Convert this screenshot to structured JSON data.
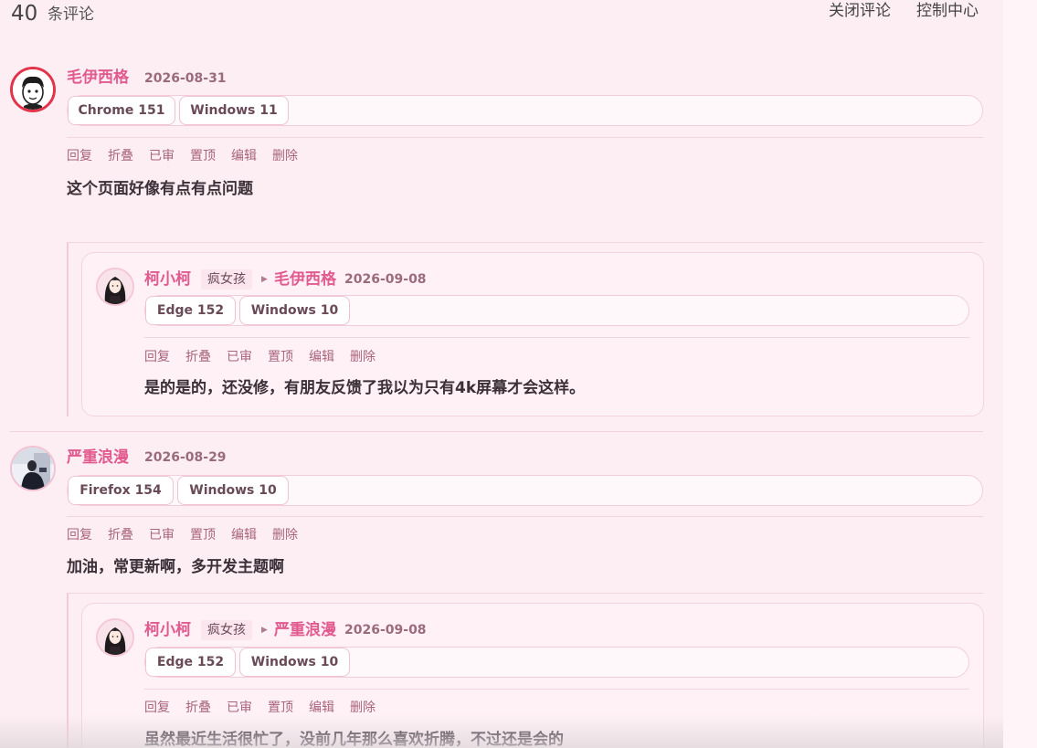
{
  "header": {
    "count": "40",
    "count_label": "条评论",
    "close_comments": "关闭评论",
    "control_center": "控制中心"
  },
  "actions": [
    "回复",
    "折叠",
    "已审",
    "置顶",
    "编辑",
    "删除"
  ],
  "comments": [
    {
      "author": "毛伊西格",
      "date": "2026-08-31",
      "browser": "Chrome 151",
      "os": "Windows 11",
      "content": "这个页面好像有点有点问题",
      "avatar": "cartoon-face-avatar",
      "reply": {
        "author": "柯小柯",
        "tag": "疯女孩",
        "reply_to": "毛伊西格",
        "date": "2026-09-08",
        "browser": "Edge 152",
        "os": "Windows 10",
        "content": "是的是的，还没修，有朋友反馈了我以为只有4k屏幕才会这样。",
        "avatar": "anime-girl-avatar"
      }
    },
    {
      "author": "严重浪漫",
      "date": "2026-08-29",
      "browser": "Firefox 154",
      "os": "Windows 10",
      "content": "加油，常更新啊，多开发主题啊",
      "avatar": "person-photo-avatar",
      "reply": {
        "author": "柯小柯",
        "tag": "疯女孩",
        "reply_to": "严重浪漫",
        "date": "2026-09-08",
        "browser": "Edge 152",
        "os": "Windows 10",
        "content": "虽然最近生活很忙了，没前几年那么喜欢折腾，不过还是会的",
        "avatar": "anime-girl-avatar"
      }
    }
  ],
  "colors": {
    "background": "#fdeef3",
    "author_name": "#e25b8f",
    "action_link": "#a9647d",
    "border": "#f3cddb"
  }
}
